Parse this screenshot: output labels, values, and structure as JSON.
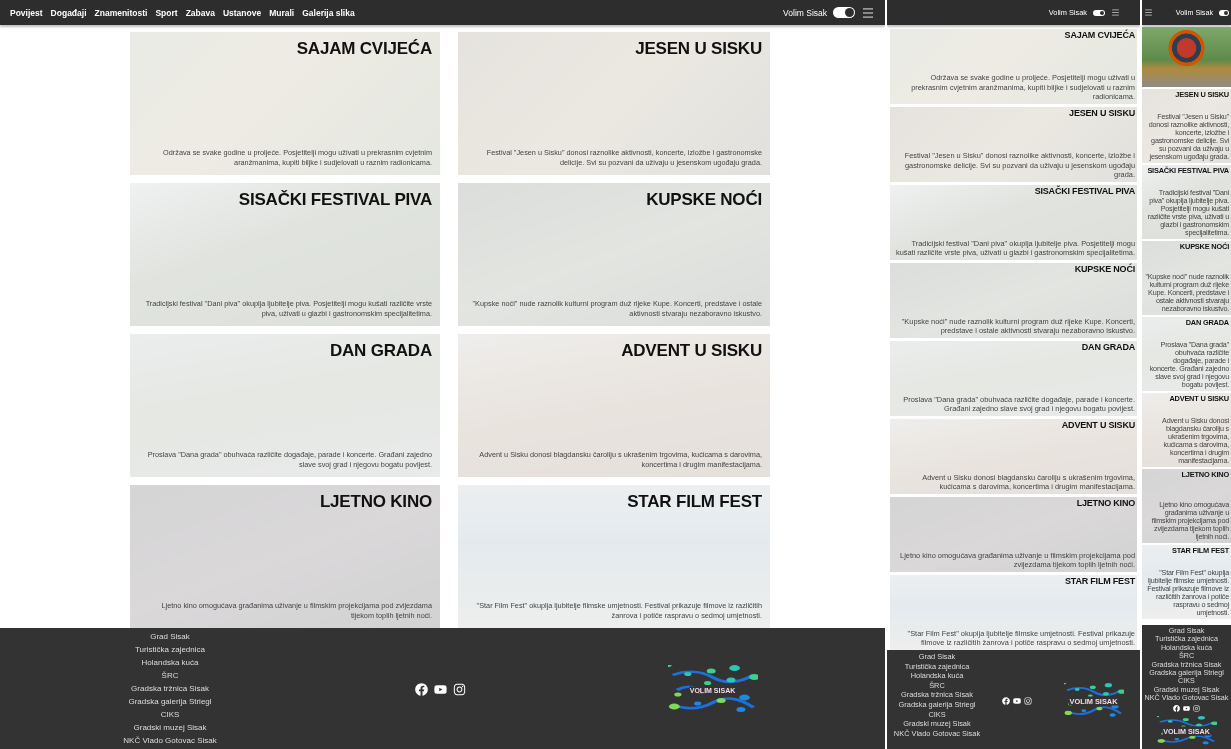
{
  "desktop": {
    "nav": {
      "links": [
        "Povijest",
        "Događaji",
        "Znamenitosti",
        "Sport",
        "Zabava",
        "Ustanove",
        "Murali",
        "Galerija slika"
      ],
      "toggle": {
        "label": "Volim Sisak",
        "on": true
      }
    },
    "cards": [
      {
        "title": "SAJAM CVIJEĆA",
        "description": "Održava se svake godine u proljeće. Posjetitelji mogu uživati u prekrasnim cvjetnim aranžmanima, kupiti biljke i sudjelovati u raznim radionicama."
      },
      {
        "title": "JESEN U SISKU",
        "description": "Festival \"Jesen u Sisku\" donosi raznolike aktivnosti, koncerte, izložbe i gastronomske delicije. Svi su pozvani da uživaju u jesenskom ugođaju grada."
      },
      {
        "title": "SISAČKI FESTIVAL PIVA",
        "description": "Tradicijski festival \"Dani piva\" okuplja ljubitelje piva. Posjetitelji mogu kušati različite vrste piva, uživati u glazbi i gastronomskim specijalitetima."
      },
      {
        "title": "KUPSKE NOĆI",
        "description": "\"Kupske noći\" nude raznolik kulturni program duž rijeke Kupe. Koncerti, predstave i ostale aktivnosti stvaraju nezaboravno iskustvo."
      },
      {
        "title": "DAN GRADA",
        "description": "Proslava \"Dana grada\" obuhvaća različite događaje, parade i koncerte. Građani zajedno slave svoj grad i njegovu bogatu povijest."
      },
      {
        "title": "ADVENT U SISKU",
        "description": "Advent u Sisku donosi blagdansku čaroliju s ukrašenim trgovima, kućicama s darovima, koncertima i drugim manifestacijama."
      },
      {
        "title": "LJETNO KINO",
        "description": "Ljetno kino omogućava građanima uživanje u filmskim projekcijama pod zvijezdama tijekom toplih ljetnih noći."
      },
      {
        "title": "STAR FILM FEST",
        "description": "\"Star Film Fest\" okuplja ljubitelje filmske umjetnosti. Festival prikazuje filmove iz različitih žanrova i potiče raspravu o sedmoj umjetnosti."
      }
    ],
    "footer": {
      "links": [
        "Grad Sisak",
        "Turistička zajednica",
        "Holandska kuća",
        "ŠRC",
        "Gradska tržnica Sisak",
        "Gradska galerija Striegl",
        "CIKS",
        "Gradski muzej Sisak",
        "NKČ Vlado Gotovac Sisak"
      ],
      "logo_text": "VOLIM SISAK"
    }
  },
  "tablet": {
    "nav": {
      "toggle": {
        "label": "Volim Sisak",
        "on": true
      }
    },
    "cards": [
      {
        "title": "SAJAM CVIJEĆA",
        "description": "Održava se svake godine u proljeće. Posjetitelji mogu uživati u prekrasnim cvjetnim aranžmanima, kupiti biljke i sudjelovati u raznim radionicama."
      },
      {
        "title": "JESEN U SISKU",
        "description": "Festival \"Jesen u Sisku\" donosi raznolike aktivnosti, koncerte, izložbe i gastronomske delicije. Svi su pozvani da uživaju u jesenskom ugođaju grada."
      },
      {
        "title": "SISAČKI FESTIVAL PIVA",
        "description": "Tradicijski festival \"Dani piva\" okuplja ljubitelje piva. Posjetitelji mogu kušati različite vrste piva, uživati u glazbi i gastronomskim specijalitetima."
      },
      {
        "title": "KUPSKE NOĆI",
        "description": "\"Kupske noći\" nude raznolik kulturni program duž rijeke Kupe. Koncerti, predstave i ostale aktivnosti stvaraju nezaboravno iskustvo."
      },
      {
        "title": "DAN GRADA",
        "description": "Proslava \"Dana grada\" obuhvaća različite događaje, parade i koncerte. Građani zajedno slave svoj grad i njegovu bogatu povijest."
      },
      {
        "title": "ADVENT U SISKU",
        "description": "Advent u Sisku donosi blagdansku čaroliju s ukrašenim trgovima, kućicama s darovima, koncertima i drugim manifestacijama."
      },
      {
        "title": "LJETNO KINO",
        "description": "Ljetno kino omogućava građanima uživanje u filmskim projekcijama pod zvijezdama tijekom toplih ljetnih noći."
      },
      {
        "title": "STAR FILM FEST",
        "description": "\"Star Film Fest\" okuplja ljubitelje filmske umjetnosti. Festival prikazuje filmove iz različitih žanrova i potiče raspravu o sedmoj umjetnosti."
      }
    ],
    "footer": {
      "links": [
        "Grad Sisak",
        "Turistička zajednica",
        "Holandska kuća",
        "ŠRC",
        "Gradska tržnica Sisak",
        "Gradska galerija Striegl",
        "CIKS",
        "Gradski muzej Sisak",
        "NKČ Vlado Gotovac Sisak"
      ],
      "logo_text": "VOLIM SISAK"
    }
  },
  "mobile": {
    "nav": {
      "toggle": {
        "label": "Volim Sisak",
        "on": true
      }
    },
    "cards": [
      {
        "kind": "photo"
      },
      {
        "kind": "text",
        "title": "JESEN U SISKU",
        "description": "Festival \"Jesen u Sisku\" donosi raznolike aktivnosti, koncerte, izložbe i gastronomske delicije. Svi su pozvani da uživaju u jesenskom ugođaju grada."
      },
      {
        "kind": "text",
        "title": "SISAČKI FESTIVAL PIVA",
        "description": "Tradicijski festival \"Dani piva\" okuplja ljubitelje piva. Posjetitelji mogu kušati različite vrste piva, uživati u glazbi i gastronomskim specijalitetima."
      },
      {
        "kind": "text",
        "title": "KUPSKE NOĆI",
        "description": "\"Kupske noći\" nude raznolik kulturni program duž rijeke Kupe. Koncerti, predstave i ostale aktivnosti stvaraju nezaboravno iskustvo."
      },
      {
        "kind": "text",
        "title": "DAN GRADA",
        "description": "Proslava \"Dana grada\" obuhvaća različite događaje, parade i koncerte. Građani zajedno slave svoj grad i njegovu bogatu povijest."
      },
      {
        "kind": "text",
        "title": "ADVENT U SISKU",
        "description": "Advent u Sisku donosi blagdansku čaroliju s ukrašenim trgovima, kućicama s darovima, koncertima i drugim manifestacijama."
      },
      {
        "kind": "text",
        "title": "LJETNO KINO",
        "description": "Ljetno kino omogućava građanima uživanje u filmskim projekcijama pod zvijezdama tijekom toplih ljetnih noći."
      },
      {
        "kind": "text",
        "title": "STAR FILM FEST",
        "description": "\"Star Film Fest\" okuplja ljubitelje filmske umjetnosti. Festival prikazuje filmove iz različitih žanrova i potiče raspravu o sedmoj umjetnosti."
      }
    ],
    "footer": {
      "links": [
        "Grad Sisak",
        "Turistička zajednica",
        "Holandska kuća",
        "ŠRC",
        "Gradska tržnica Sisak",
        "Gradska galerija Striegl",
        "CIKS",
        "Gradski muzej Sisak",
        "NKČ Vlado Gotovac Sisak"
      ],
      "logo_text": "VOLIM SISAK"
    }
  }
}
